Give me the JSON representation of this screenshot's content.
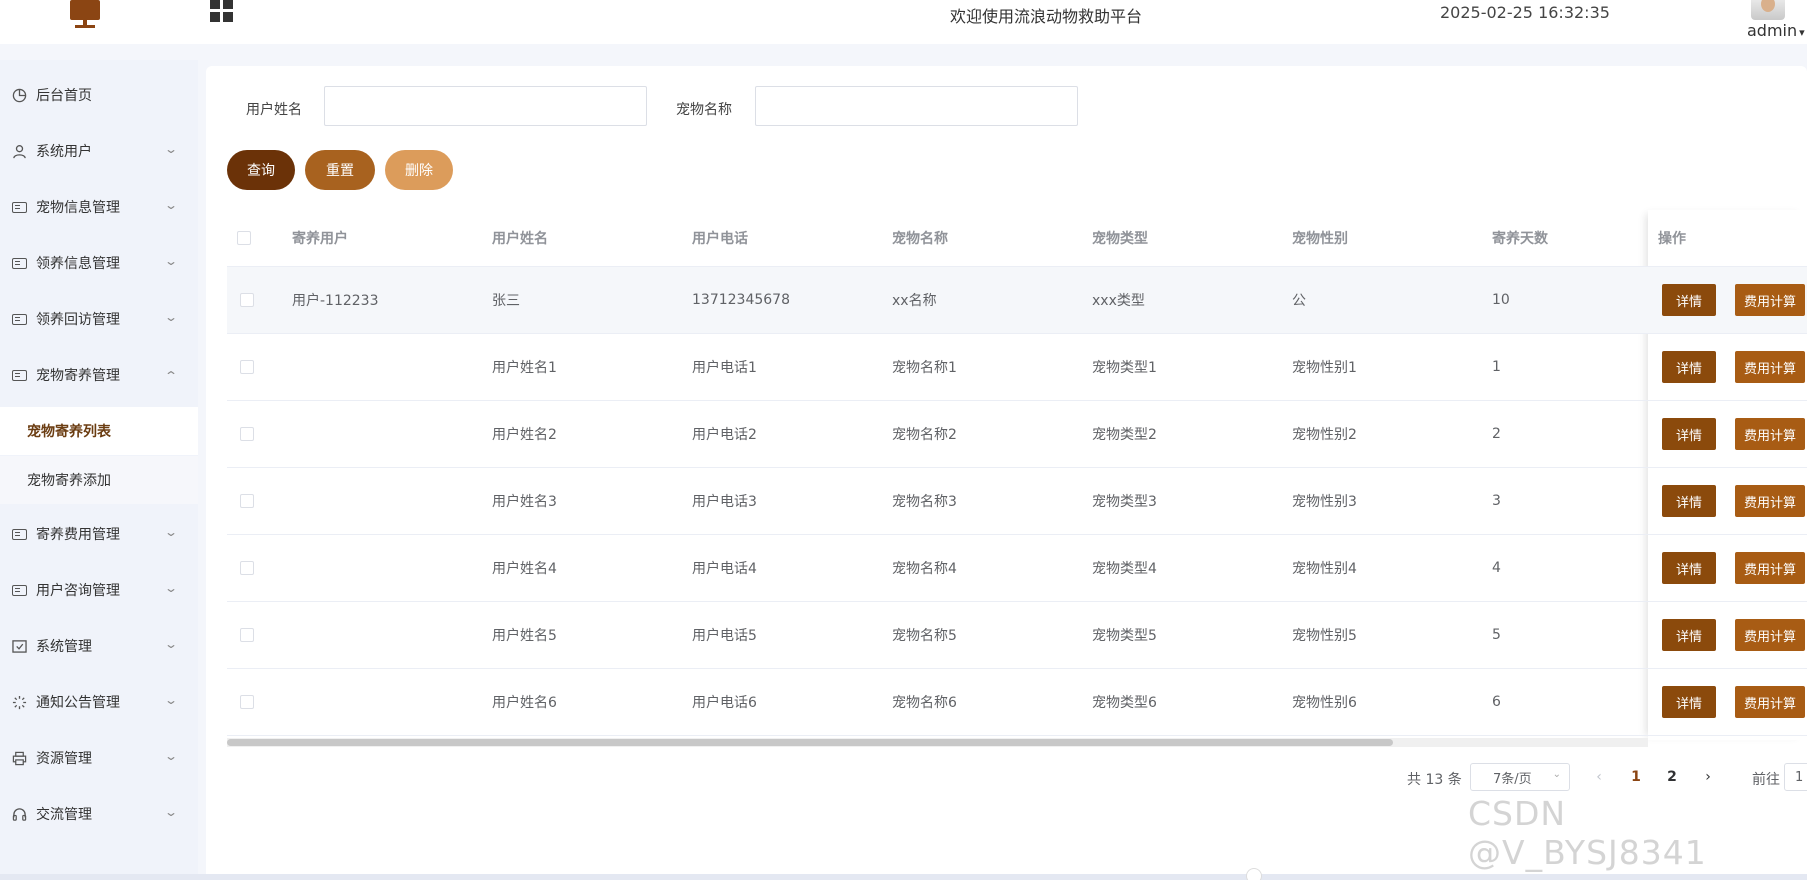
{
  "header": {
    "title": "欢迎使用流浪动物救助平台",
    "datetime": "2025-02-25 16:32:35",
    "user": "admin"
  },
  "sidebar": {
    "items": [
      {
        "label": "后台首页",
        "icon": "pie-chart-icon"
      },
      {
        "label": "系统用户",
        "icon": "user-icon"
      },
      {
        "label": "宠物信息管理",
        "icon": "card-icon"
      },
      {
        "label": "领养信息管理",
        "icon": "card-icon"
      },
      {
        "label": "领养回访管理",
        "icon": "card-icon"
      },
      {
        "label": "宠物寄养管理",
        "icon": "card-icon"
      },
      {
        "label": "寄养费用管理",
        "icon": "card-icon"
      },
      {
        "label": "用户咨询管理",
        "icon": "card-icon"
      },
      {
        "label": "系统管理",
        "icon": "checkbox-icon"
      },
      {
        "label": "通知公告管理",
        "icon": "loading-icon"
      },
      {
        "label": "资源管理",
        "icon": "printer-icon"
      },
      {
        "label": "交流管理",
        "icon": "headset-icon"
      }
    ],
    "subitems": [
      {
        "label": "宠物寄养列表"
      },
      {
        "label": "宠物寄养添加"
      }
    ]
  },
  "search": {
    "user_name_label": "用户姓名",
    "pet_name_label": "宠物名称",
    "query_label": "查询",
    "reset_label": "重置",
    "delete_label": "删除"
  },
  "table": {
    "columns": [
      "寄养用户",
      "用户姓名",
      "用户电话",
      "宠物名称",
      "宠物类型",
      "宠物性别",
      "寄养天数",
      "操作"
    ],
    "rows": [
      {
        "user": "用户-112233",
        "name": "张三",
        "phone": "13712345678",
        "pet": "xx名称",
        "type": "xxx类型",
        "gender": "公",
        "days": "10"
      },
      {
        "user": "",
        "name": "用户姓名1",
        "phone": "用户电话1",
        "pet": "宠物名称1",
        "type": "宠物类型1",
        "gender": "宠物性别1",
        "days": "1"
      },
      {
        "user": "",
        "name": "用户姓名2",
        "phone": "用户电话2",
        "pet": "宠物名称2",
        "type": "宠物类型2",
        "gender": "宠物性别2",
        "days": "2"
      },
      {
        "user": "",
        "name": "用户姓名3",
        "phone": "用户电话3",
        "pet": "宠物名称3",
        "type": "宠物类型3",
        "gender": "宠物性别3",
        "days": "3"
      },
      {
        "user": "",
        "name": "用户姓名4",
        "phone": "用户电话4",
        "pet": "宠物名称4",
        "type": "宠物类型4",
        "gender": "宠物性别4",
        "days": "4"
      },
      {
        "user": "",
        "name": "用户姓名5",
        "phone": "用户电话5",
        "pet": "宠物名称5",
        "type": "宠物类型5",
        "gender": "宠物性别5",
        "days": "5"
      },
      {
        "user": "",
        "name": "用户姓名6",
        "phone": "用户电话6",
        "pet": "宠物名称6",
        "type": "宠物类型6",
        "gender": "宠物性别6",
        "days": "6"
      }
    ],
    "detail_label": "详情",
    "fee_label": "费用计算"
  },
  "pagination": {
    "total": "共 13 条",
    "page_size": "7条/页",
    "pages": [
      "1",
      "2"
    ],
    "jump_label": "前往",
    "jump_value": "1"
  },
  "watermark": "CSDN @V_BYSJ8341",
  "colors": {
    "brand": "#8b4513",
    "query_button": "#6b3208",
    "reset_button": "#a8621f",
    "delete_button": "#dc9c5b",
    "detail_button": "#8b4a0c",
    "fee_button": "#a85c14"
  }
}
